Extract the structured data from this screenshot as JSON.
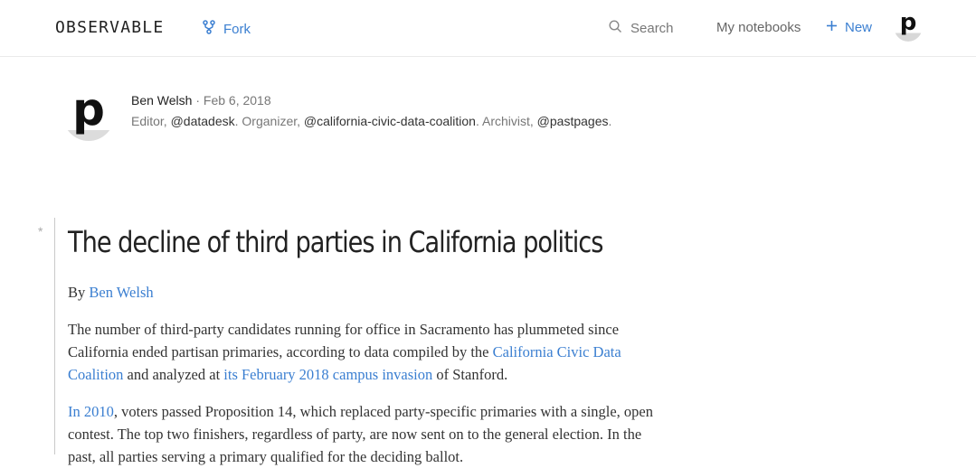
{
  "header": {
    "logo": "OBSERVABLE",
    "fork_label": "Fork",
    "search_label": "Search",
    "my_notebooks_label": "My notebooks",
    "new_label": "New",
    "avatar_letter": "p"
  },
  "author": {
    "avatar_letter": "p",
    "name": "Ben Welsh",
    "separator": " · ",
    "date": "Feb 6, 2018",
    "bio": [
      {
        "text": "Editor, ",
        "type": "plain"
      },
      {
        "text": "@datadesk",
        "type": "handle"
      },
      {
        "text": ". Organizer, ",
        "type": "plain"
      },
      {
        "text": "@california-civic-data-coalition",
        "type": "handle"
      },
      {
        "text": ". Archivist, ",
        "type": "plain"
      },
      {
        "text": "@pastpages",
        "type": "handle"
      },
      {
        "text": ".",
        "type": "plain"
      }
    ]
  },
  "cell": {
    "marker": "*"
  },
  "article": {
    "title": "The decline of third parties in California politics",
    "byline_prefix": "By ",
    "byline_link": "Ben Welsh",
    "p1": {
      "text1": "The number of third-party candidates running for office in Sacramento has plummeted since California ended partisan primaries, according to data compiled by the ",
      "link1": "California Civic Data Coalition",
      "text2": " and analyzed at ",
      "link2": "its February 2018 campus invasion",
      "text3": " of Stanford."
    },
    "p2": {
      "link1": "In 2010",
      "text1": ", voters passed Proposition 14, which replaced party-specific primaries with a single, open contest. The top two finishers, regardless of party, are now sent on to the general election. In the past, all parties serving a primary qualified for the deciding ballot."
    }
  },
  "colors": {
    "link": "#3b7fd1",
    "text": "#333333",
    "muted": "#777777",
    "border": "#eaeaea"
  }
}
